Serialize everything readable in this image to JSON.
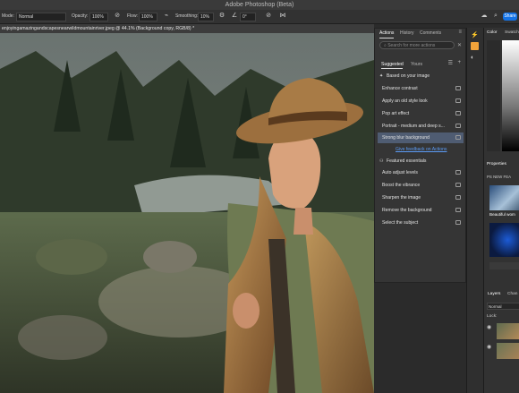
{
  "app_title": "Adobe Photoshop (Beta)",
  "options_bar": {
    "mode_label": "Mode:",
    "mode_value": "Normal",
    "opacity_label": "Opacity:",
    "opacity_value": "100%",
    "flow_label": "Flow:",
    "flow_value": "100%",
    "smoothing_label": "Smoothing:",
    "smoothing_value": "10%",
    "angle_value": "0°",
    "share_label": "Share"
  },
  "document_tab": "enjoyingamazingandscapesnearwildmountainriver.jpeg @ 44.1% (Background copy, RGB/8) *",
  "actions_panel": {
    "tabs": [
      "Actions",
      "History",
      "Comments"
    ],
    "search_placeholder": "Search for more actions",
    "subtabs": [
      "Suggested",
      "Yours"
    ],
    "based_on_label": "Based on your image",
    "group1": [
      "Enhance contrast",
      "Apply an old style look",
      "Pop art effect",
      "Portrait - medium and deep s...",
      "Strong blur background"
    ],
    "feedback_link": "Give feedback on Actions",
    "featured_label": "Featured essentials",
    "group2": [
      "Auto adjust levels",
      "Boost the vibrance",
      "Sharpen the image",
      "Remove the background",
      "Select the subject"
    ]
  },
  "right_panel": {
    "color_tab": "Color",
    "swatches_tab": "Swatch",
    "properties_tab": "Properties",
    "new_feature_label": "PS NEW FEA",
    "beautiful_label": "Beautiful wom",
    "layers_tab": "Layers",
    "channels_tab": "Chan",
    "blend_mode": "Normal",
    "lock_label": "Lock:"
  },
  "colors": {
    "selected_row": "#4f5c72",
    "link_blue": "#5b9bf5",
    "accent_blue": "#1473e6",
    "hat_brown": "#9c6f3e",
    "jacket_olive": "#6e7a52"
  }
}
